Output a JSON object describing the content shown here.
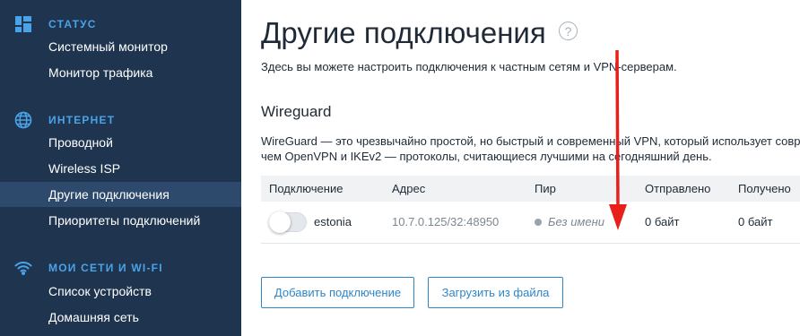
{
  "sidebar": {
    "sections": [
      {
        "title": "СТАТУС",
        "icon": "dashboard-icon",
        "items": [
          "Системный монитор",
          "Монитор трафика"
        ]
      },
      {
        "title": "ИНТЕРНЕТ",
        "icon": "globe-icon",
        "items": [
          "Проводной",
          "Wireless ISP",
          "Другие подключения",
          "Приоритеты подключений"
        ]
      },
      {
        "title": "МОИ СЕТИ И WI-FI",
        "icon": "wifi-icon",
        "items": [
          "Список устройств",
          "Домашняя сеть"
        ]
      }
    ],
    "active_item": "Другие подключения"
  },
  "main": {
    "title": "Другие подключения",
    "help_symbol": "?",
    "description": "Здесь вы можете настроить подключения к частным сетям и VPN-серверам.",
    "wireguard": {
      "title": "Wireguard",
      "description_line1": "WireGuard — это чрезвычайно простой, но быстрый и современный VPN, который использует соврем",
      "description_line2": "чем OpenVPN и IKEv2 — протоколы, считающиеся лучшими на сегодняшний день.",
      "columns": [
        "Подключение",
        "Адрес",
        "Пир",
        "Отправлено",
        "Получено"
      ],
      "rows": [
        {
          "enabled": false,
          "name": "estonia",
          "address": "10.7.0.125/32:48950",
          "peer": "Без имени",
          "sent": "0 байт",
          "received": "0 байт"
        }
      ]
    },
    "buttons": {
      "add": "Добавить подключение",
      "upload": "Загрузить из файла"
    }
  },
  "colors": {
    "sidebar_bg": "#1e344f",
    "sidebar_active": "#2d4a6c",
    "accent": "#4aa3e8",
    "button": "#2e86c8",
    "annotation_arrow": "#e8201c"
  }
}
